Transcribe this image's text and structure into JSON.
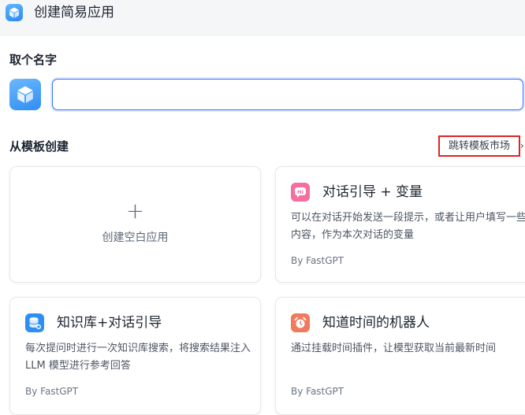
{
  "header": {
    "title": "创建简易应用"
  },
  "name_section": {
    "title": "取个名字",
    "input_value": "",
    "input_placeholder": ""
  },
  "template_section": {
    "title": "从模板创建",
    "market_link": "跳转模板市场",
    "blank_card": {
      "plus": "+",
      "label": "创建空白应用"
    },
    "templates": [
      {
        "name": "对话引导 + 变量",
        "desc": "可以在对话开始发送一段提示，或者让用户填写一些内容，作为本次对话的变量",
        "author": "By FastGPT",
        "icon": "hi-chat-icon",
        "color": "#f46fa0"
      },
      {
        "name": "知识库+对话引导",
        "desc": "每次提问时进行一次知识库搜索，将搜索结果注入 LLM 模型进行参考回答",
        "author": "By FastGPT",
        "icon": "database-icon",
        "color": "#2e8ff3"
      },
      {
        "name": "知道时间的机器人",
        "desc": "通过挂载时间插件，让模型获取当前最新时间",
        "author": "By FastGPT",
        "icon": "alarm-clock-icon",
        "color": "#f07a5e"
      }
    ]
  },
  "colors": {
    "accent": "#3370ff",
    "highlight_border": "#e02424"
  }
}
